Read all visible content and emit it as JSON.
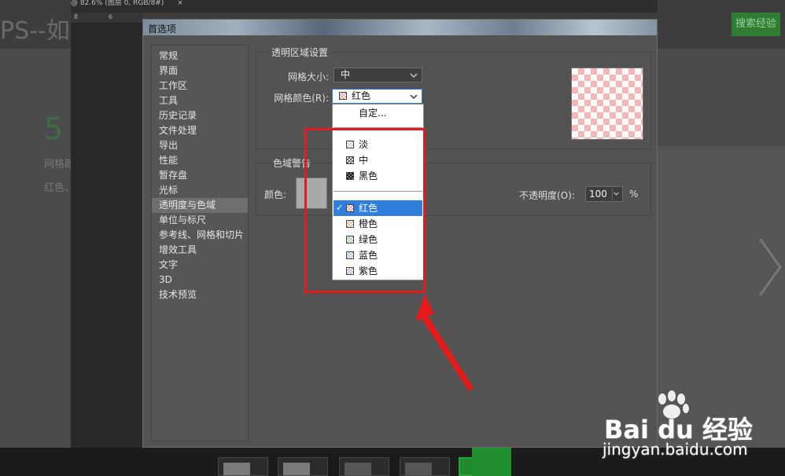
{
  "background_page": {
    "title_fragment": "PS--如何",
    "search_button": "搜索经验",
    "step_number": "5",
    "line1_fragment": "网格颜",
    "line2_fragment": "红色、"
  },
  "photoshop": {
    "doc_tab": "@ 82.6% (图层 0, RGB/8#)",
    "doc_tab_close": "×",
    "ruler_marks": [
      "8",
      "6"
    ]
  },
  "dialog": {
    "title": "首选项",
    "nav": [
      {
        "label": "常规"
      },
      {
        "label": "界面"
      },
      {
        "label": "工作区"
      },
      {
        "label": "工具"
      },
      {
        "label": "历史记录"
      },
      {
        "label": "文件处理"
      },
      {
        "label": "导出"
      },
      {
        "label": "性能"
      },
      {
        "label": "暂存盘"
      },
      {
        "label": "光标"
      },
      {
        "label": "透明度与色域"
      },
      {
        "label": "单位与标尺"
      },
      {
        "label": "参考线、网格和切片"
      },
      {
        "label": "增效工具"
      },
      {
        "label": "文字"
      },
      {
        "label": "3D"
      },
      {
        "label": "技术预览"
      }
    ],
    "active_nav_index": 10,
    "transparency": {
      "section_title": "透明区域设置",
      "grid_size_label": "网格大小:",
      "grid_size_value": "中",
      "grid_color_label": "网格颜色(R):",
      "grid_color_value": "红色"
    },
    "gamut": {
      "section_title": "色域警告",
      "color_label": "颜色:",
      "opacity_label": "不透明度(O):",
      "opacity_value": "100",
      "opacity_unit": "%"
    },
    "dropdown": {
      "custom": "自定...",
      "light": "淡",
      "medium": "中",
      "dark": "黑色",
      "red": "红色",
      "orange": "橙色",
      "green": "绿色",
      "blue": "蓝色",
      "purple": "紫色",
      "checkmark": "✓"
    }
  },
  "watermark": {
    "brand": "Bai du 经验",
    "url": "jingyan.baidu.com"
  },
  "colors": {
    "highlight": "#2f7fdc",
    "annotation_red": "#e31b1b",
    "dialog_bg": "#535353"
  }
}
